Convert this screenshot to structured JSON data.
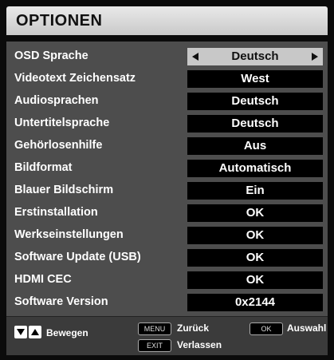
{
  "title": "OPTIONEN",
  "rows": [
    {
      "label": "OSD Sprache",
      "value": "Deutsch",
      "selected": true
    },
    {
      "label": "Videotext Zeichensatz",
      "value": "West"
    },
    {
      "label": "Audiosprachen",
      "value": "Deutsch"
    },
    {
      "label": "Untertitelsprache",
      "value": "Deutsch"
    },
    {
      "label": "Gehörlosenhilfe",
      "value": "Aus"
    },
    {
      "label": "Bildformat",
      "value": "Automatisch"
    },
    {
      "label": "Blauer Bildschirm",
      "value": "Ein"
    },
    {
      "label": "Erstinstallation",
      "value": "OK"
    },
    {
      "label": "Werkseinstellungen",
      "value": "OK"
    },
    {
      "label": "Software Update (USB)",
      "value": "OK"
    },
    {
      "label": "HDMI CEC",
      "value": "OK"
    },
    {
      "label": "Software Version",
      "value": "0x2144"
    }
  ],
  "footer": {
    "move_label": "Bewegen",
    "menu_key": "MENU",
    "back_label": "Zurück",
    "exit_key": "EXIT",
    "exit_label": "Verlassen",
    "ok_key": "OK",
    "select_label": "Auswahl"
  }
}
